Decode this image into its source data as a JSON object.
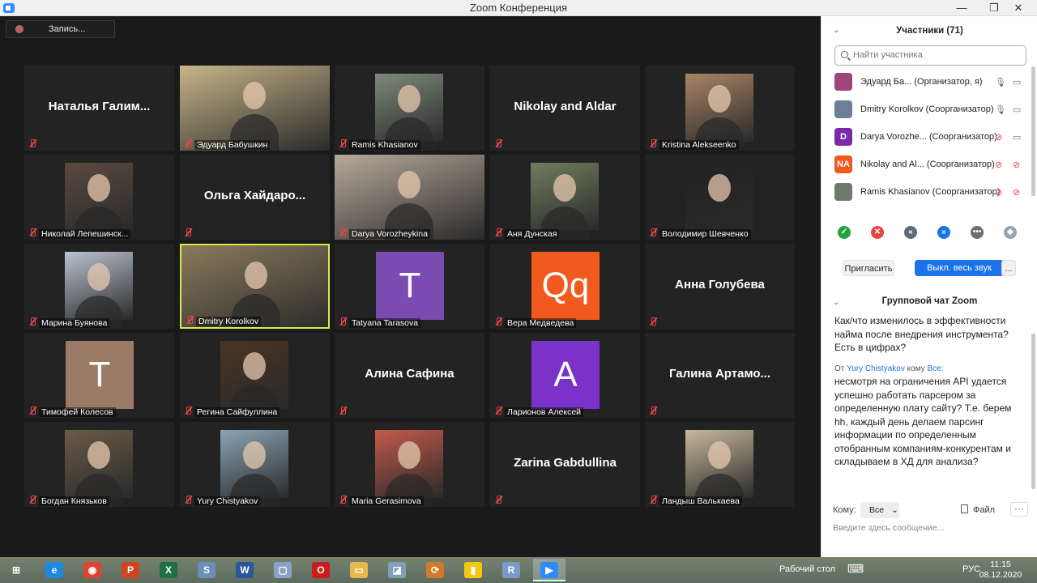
{
  "window": {
    "title": "Zoom Конференция",
    "minimize": "—",
    "maximize": "❐",
    "close": "✕"
  },
  "recording": {
    "label": "Запись..."
  },
  "tiles": [
    {
      "name": "Наталья Галим...",
      "label": "",
      "kind": "name"
    },
    {
      "name": "",
      "label": "Эдуард Бабушкин",
      "kind": "video",
      "color": "#c7b58a"
    },
    {
      "name": "",
      "label": "Ramis Khasianov",
      "kind": "photo",
      "color": "#7d8a7a"
    },
    {
      "name": "Nikolay and Aldar",
      "label": "",
      "kind": "name"
    },
    {
      "name": "",
      "label": "Kristina Alekseenko",
      "kind": "photo",
      "color": "#a88566"
    },
    {
      "name": "",
      "label": "Николай Лепешинск...",
      "kind": "photo",
      "color": "#5a4a40"
    },
    {
      "name": "Ольга Хайдаро...",
      "label": "",
      "kind": "name"
    },
    {
      "name": "",
      "label": "Darya Vorozheykina",
      "kind": "video",
      "color": "#b7a99a"
    },
    {
      "name": "",
      "label": "Аня Дунская",
      "kind": "photo",
      "color": "#6f7d5e"
    },
    {
      "name": "",
      "label": "Володимир Шевченко",
      "kind": "photo",
      "color": "#222222"
    },
    {
      "name": "",
      "label": "Марина Буянова",
      "kind": "photo",
      "color": "#b9c3cf"
    },
    {
      "name": "",
      "label": "Dmitry Korolkov",
      "kind": "video",
      "color": "#8a7a5c",
      "active": true
    },
    {
      "name": "",
      "label": "Tatyana Tarasova",
      "kind": "letter",
      "letter": "T",
      "color": "#7a4bb0"
    },
    {
      "name": "",
      "label": "Вера Медведева",
      "kind": "letter",
      "letter": "Qq",
      "color": "#f05a1e"
    },
    {
      "name": "Анна Голубева",
      "label": "",
      "kind": "name"
    },
    {
      "name": "",
      "label": "Тимофей Колесов",
      "kind": "letter",
      "letter": "T",
      "color": "#9b7b66"
    },
    {
      "name": "",
      "label": "Регина Сайфуллина",
      "kind": "photo",
      "color": "#4a3424"
    },
    {
      "name": "Алина Сафина",
      "label": "",
      "kind": "name"
    },
    {
      "name": "",
      "label": "Ларионов Алексей",
      "kind": "letter",
      "letter": "A",
      "color": "#7a32c8"
    },
    {
      "name": "Галина Артамо...",
      "label": "",
      "kind": "name"
    },
    {
      "name": "",
      "label": "Богдан Князьков",
      "kind": "photo",
      "color": "#6a5a48"
    },
    {
      "name": "",
      "label": "Yury Chistyakov",
      "kind": "photo",
      "color": "#8aa4b6"
    },
    {
      "name": "",
      "label": "Maria Gerasimova",
      "kind": "photo",
      "color": "#c25a4a"
    },
    {
      "name": "Zarina Gabdullina",
      "label": "",
      "kind": "name"
    },
    {
      "name": "",
      "label": "Ландыш Валькаева",
      "kind": "photo",
      "color": "#c7b89c"
    }
  ],
  "participants": {
    "header": "Участники (71)",
    "search_placeholder": "Найти участника",
    "list": [
      {
        "name": "Эдуард Ба...  (Организатор, я)",
        "initials": "",
        "color": "#a0447a",
        "muted": false,
        "video_off": false
      },
      {
        "name": "Dmitry Korolkov (Соорганизатор)",
        "initials": "",
        "color": "#6c7f97",
        "muted": false,
        "video_off": false
      },
      {
        "name": "Darya Vorozhe...  (Соорганизатор)",
        "initials": "D",
        "color": "#7a2aa8",
        "muted": true,
        "video_off": false
      },
      {
        "name": "Nikolay and Al...  (Соорганизатор)",
        "initials": "NA",
        "color": "#f05a1e",
        "muted": true,
        "video_off": true
      },
      {
        "name": "Ramis Khasianov (Соорганизатор)",
        "initials": "",
        "color": "#6d7a6a",
        "muted": true,
        "video_off": true
      }
    ],
    "reactions": [
      {
        "name": "yes-reaction",
        "glyph": "✓",
        "color": "#23a33a"
      },
      {
        "name": "no-reaction",
        "glyph": "✕",
        "color": "#e64545"
      },
      {
        "name": "slower-reaction",
        "glyph": "«",
        "color": "#5f6a78"
      },
      {
        "name": "faster-reaction",
        "glyph": "»",
        "color": "#1a73e8"
      },
      {
        "name": "more-reaction",
        "glyph": "•••",
        "color": "#6e6e6e"
      },
      {
        "name": "clear-reaction",
        "glyph": "◆",
        "color": "#9aa3b2"
      }
    ],
    "invite_label": "Пригласить",
    "mute_all_label": "Выкл. весь звук",
    "more_label": "..."
  },
  "chat": {
    "title": "Групповой чат Zoom",
    "message1": "Как/что изменилось в эффективности найма после внедрения инструмента? Есть в цифрах?",
    "from_prefix": "От",
    "from_user": "Yury Chistyakov",
    "from_to": "кому",
    "from_target": "Все:",
    "message2": "несмотря на ограничения API удается успешно работать парсером за определенную плату сайту? Т.е. берем hh, каждый день делаем парсинг информации по определенным отобранным компаниям-конкурентам и складываем в ХД для анализа?",
    "to_label": "Кому:",
    "to_value": "Все",
    "file_label": "Файл",
    "more_label": "···",
    "input_placeholder": "Введите здесь сообщение..."
  },
  "taskbar": {
    "apps": [
      {
        "name": "start-button",
        "glyph": "⊞",
        "color": "transparent"
      },
      {
        "name": "ie-app",
        "glyph": "e",
        "color": "#1e88e5"
      },
      {
        "name": "chrome-app",
        "glyph": "◉",
        "color": "#dd4433"
      },
      {
        "name": "powerpoint-app",
        "glyph": "P",
        "color": "#d04423"
      },
      {
        "name": "excel-app",
        "glyph": "X",
        "color": "#1e7145"
      },
      {
        "name": "skype-app",
        "glyph": "S",
        "color": "#6a8fb8"
      },
      {
        "name": "word-app",
        "glyph": "W",
        "color": "#2b579a"
      },
      {
        "name": "screen-app",
        "glyph": "▢",
        "color": "#8aa2c8"
      },
      {
        "name": "opera-app",
        "glyph": "O",
        "color": "#cc1b1b"
      },
      {
        "name": "explorer-app",
        "glyph": "▭",
        "color": "#e8b84a"
      },
      {
        "name": "notes-app",
        "glyph": "◪",
        "color": "#7fa0b8"
      },
      {
        "name": "sync-app",
        "glyph": "⟳",
        "color": "#d07a2a"
      },
      {
        "name": "powerbi-app",
        "glyph": "▮",
        "color": "#f2c811"
      },
      {
        "name": "r-app",
        "glyph": "R",
        "color": "#7a9ac8"
      },
      {
        "name": "zoom-app",
        "glyph": "▶",
        "color": "#2d8cff"
      }
    ],
    "desktop_label": "Рабочий стол",
    "keyboard_label": "⌨",
    "lang": "РУС",
    "time": "11:15",
    "date": "08.12.2020"
  }
}
